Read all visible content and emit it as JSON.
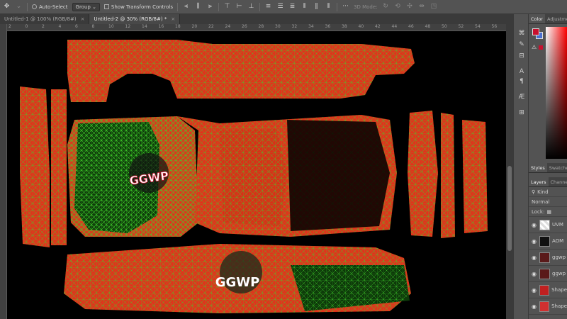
{
  "options_bar": {
    "auto_select_label": "Auto-Select",
    "group_value": "Group",
    "show_transform_label": "Show Transform Controls",
    "mode_3d_label": "3D Mode:"
  },
  "tabs": [
    {
      "label": "Untitled-1 @ 100% (RGB/8#)",
      "active": false
    },
    {
      "label": "Untitled-2 @ 30% (RGB/8#) *",
      "active": true
    }
  ],
  "ruler_ticks": [
    "2",
    "0",
    "2",
    "4",
    "6",
    "8",
    "10",
    "12",
    "14",
    "16",
    "18",
    "20",
    "22",
    "24",
    "26",
    "28",
    "30",
    "32",
    "34",
    "36",
    "38",
    "40",
    "42",
    "44",
    "46",
    "48",
    "50",
    "52",
    "54",
    "56"
  ],
  "color_panel": {
    "tab_color": "Color",
    "tab_adjustments": "Adjustmen",
    "foreground": "#c8102e",
    "background": "#4a6fd0"
  },
  "mid_panel": {
    "tab_styles": "Styles",
    "tab_swatches": "Swatches"
  },
  "layers_panel": {
    "tab_layers": "Layers",
    "tab_channels": "Channels",
    "kind_label": "Kind",
    "blend_mode": "Normal",
    "lock_label": "Lock:",
    "layers": [
      {
        "name": "UVM"
      },
      {
        "name": "AOM"
      },
      {
        "name": "ggwp"
      },
      {
        "name": "ggwp"
      },
      {
        "name": "Shape"
      },
      {
        "name": "Shape"
      }
    ]
  },
  "canvas": {
    "logo_text_1": "GGWP",
    "logo_text_2": "GGWP",
    "wire_color": "#3fd12a",
    "paint_color": "#e0341c"
  }
}
